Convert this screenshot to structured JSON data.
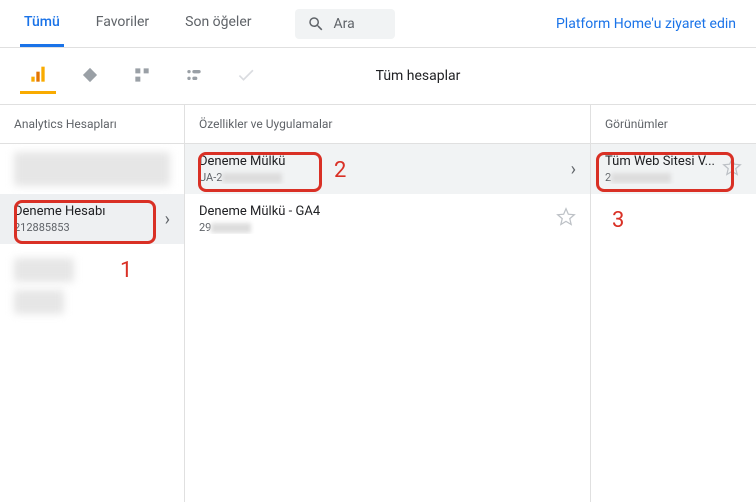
{
  "topbar": {
    "tabs": {
      "all": "Tümü",
      "favorites": "Favoriler",
      "recent": "Son öğeler"
    },
    "search_placeholder": "Ara",
    "platform_link": "Platform Home'u ziyaret edin"
  },
  "iconbar": {
    "title": "Tüm hesaplar"
  },
  "columns": {
    "accounts": {
      "header": "Analytics Hesapları",
      "selected": {
        "title": "Deneme Hesabı",
        "sub": "212885853"
      }
    },
    "properties": {
      "header": "Özellikler ve Uygulamalar",
      "items": [
        {
          "title": "Deneme Mülkü",
          "sub_prefix": "UA-2",
          "selected": true
        },
        {
          "title": "Deneme Mülkü - GA4",
          "sub_prefix": "29",
          "selected": false
        }
      ]
    },
    "views": {
      "header": "Görünümler",
      "selected": {
        "title": "Tüm Web Sitesi V...",
        "sub_prefix": "2"
      }
    }
  },
  "annotations": {
    "a1": "1",
    "a2": "2",
    "a3": "3"
  }
}
